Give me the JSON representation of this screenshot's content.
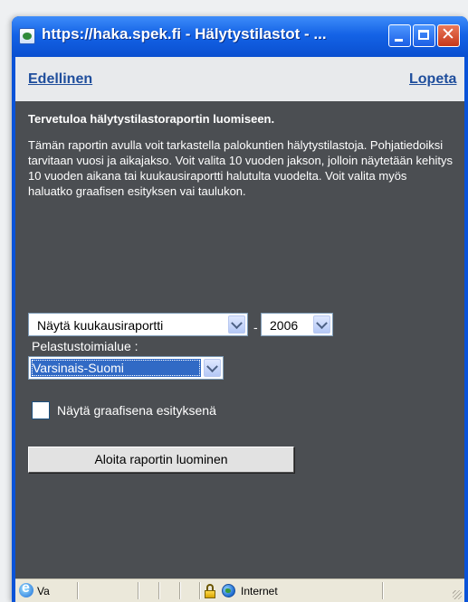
{
  "window": {
    "title": "https://haka.spek.fi - Hälytystilastot - ..."
  },
  "nav": {
    "previous": "Edellinen",
    "quit": "Lopeta"
  },
  "content": {
    "heading": "Tervetuloa hälytystilastoraportin luomiseen.",
    "intro": "Tämän raportin avulla voit tarkastella palokuntien hälytystilastoja. Pohjatiedoiksi tarvitaan vuosi ja aikajakso. Voit valita 10 vuoden jakson, jolloin näytetään kehitys 10 vuoden aikana tai kuukausiraportti halutulta vuodelta. Voit valita myös haluatko graafisen esityksen vai taulukon."
  },
  "form": {
    "report_type": "Näytä kuukausiraportti",
    "separator": "-",
    "year": "2006",
    "region_label": "Pelastustoimialue :",
    "region": "Varsinais-Suomi",
    "graph_checkbox_label": "Näytä graafisena esityksenä",
    "graph_checked": false,
    "submit_label": "Aloita raportin luominen"
  },
  "statusbar": {
    "text": "Va",
    "zone": "Internet"
  },
  "colors": {
    "titlebar": "#0a53d8",
    "client_background": "#4b4e52",
    "nav_background": "#e8eaec",
    "link": "#1f4e9c",
    "selection": "#316ac5"
  }
}
